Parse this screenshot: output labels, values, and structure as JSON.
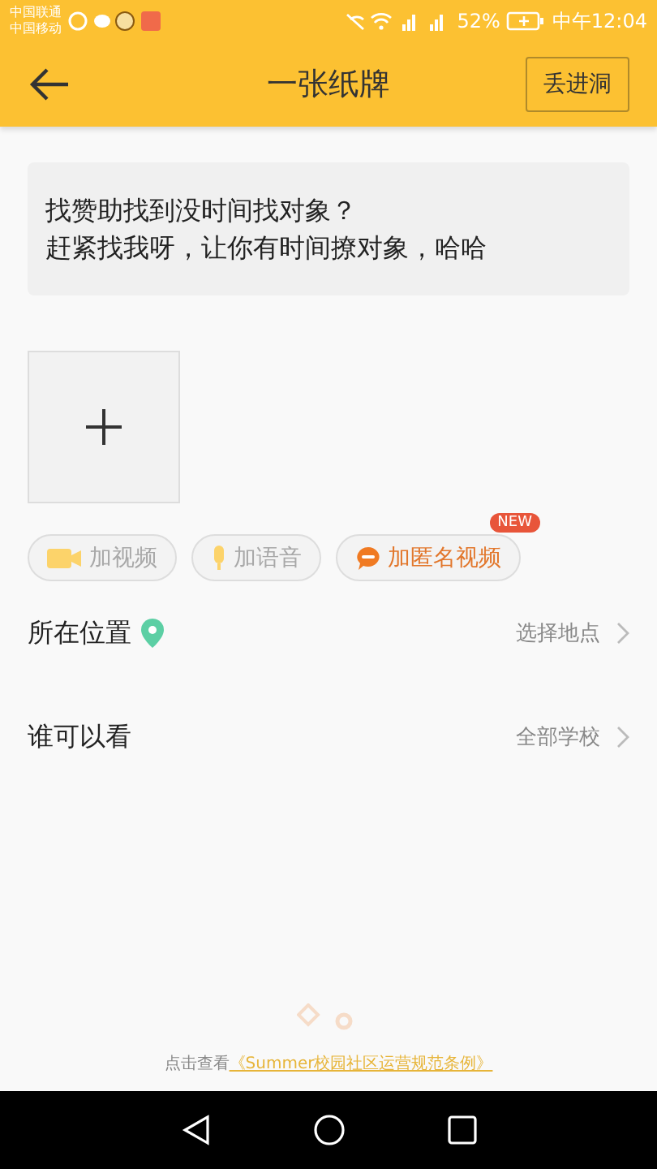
{
  "status_bar": {
    "carriers": [
      "中国联通",
      "中国移动"
    ],
    "battery": "52%",
    "time": "中午12:04"
  },
  "header": {
    "title": "一张纸牌",
    "action": "丢进洞"
  },
  "post": {
    "lines": [
      "找赞助找到没时间找对象？",
      "赶紧找我呀，让你有时间撩对象，哈哈"
    ]
  },
  "attachments": [
    {
      "kind": "video",
      "label": "加视频",
      "disabled": true
    },
    {
      "kind": "voice",
      "label": "加语音",
      "disabled": true
    },
    {
      "kind": "anonymous",
      "label": "加匿名视频",
      "disabled": false,
      "badge": "NEW"
    }
  ],
  "settings": [
    {
      "kind": "location",
      "label": "所在位置",
      "value": "选择地点"
    },
    {
      "kind": "visibility",
      "label": "谁可以看",
      "value": "全部学校"
    }
  ],
  "footer": {
    "prefix": "点击查看",
    "link": "《Summer校园社区运营规范条例》"
  }
}
